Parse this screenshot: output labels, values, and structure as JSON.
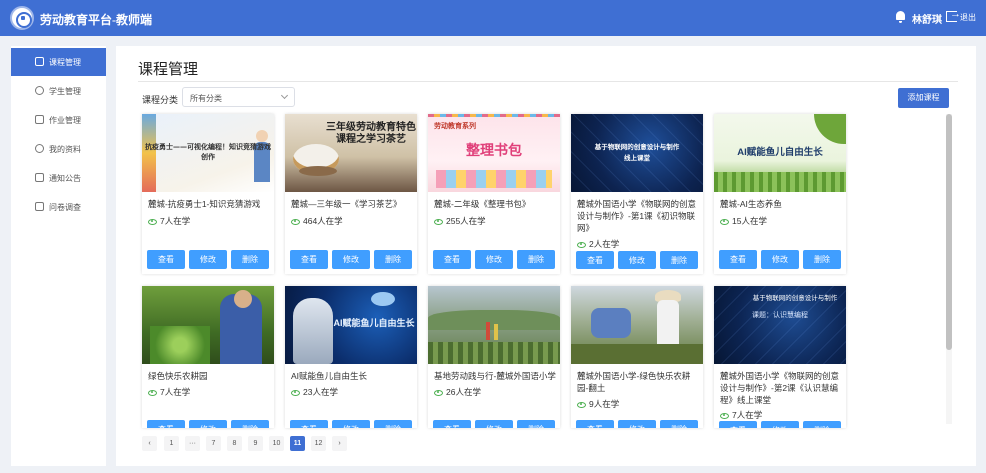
{
  "header": {
    "app_title": "劳动教育平台-教师端",
    "username": "林舒琪",
    "logout_label": "退出"
  },
  "sidebar": {
    "items": [
      {
        "label": "课程管理",
        "active": true,
        "icon": "document-icon"
      },
      {
        "label": "学生管理",
        "active": false,
        "icon": "student-icon"
      },
      {
        "label": "作业管理",
        "active": false,
        "icon": "homework-icon"
      },
      {
        "label": "我的资料",
        "active": false,
        "icon": "user-icon"
      },
      {
        "label": "通知公告",
        "active": false,
        "icon": "speaker-icon"
      },
      {
        "label": "问卷调查",
        "active": false,
        "icon": "survey-icon"
      }
    ]
  },
  "main": {
    "title": "课程管理",
    "filter_label": "课程分类",
    "filter_value": "所有分类",
    "add_button": "添加课程",
    "actions": {
      "view": "查看",
      "edit": "修改",
      "delete": "删除"
    }
  },
  "courses": [
    {
      "title": "麓城-抗疫勇士1-知识竞猜游戏",
      "learners": "7人在学",
      "thumb_caption": "抗疫勇士——可视化编程！知识竞猜游戏创作"
    },
    {
      "title": "麓城—三年级一《学习茶艺》",
      "learners": "464人在学",
      "thumb_caption": "三年级劳动教育特色课程之学习茶艺"
    },
    {
      "title": "麓城-二年级《整理书包》",
      "learners": "255人在学",
      "thumb_caption": "整理书包",
      "thumb_subcaption": "劳动教育系列"
    },
    {
      "title": "麓城外国语小学《物联网的创意设计与制作》-第1课《初识物联网》",
      "learners": "2人在学",
      "thumb_caption": "基于物联网的创意设计与制作 线上课堂"
    },
    {
      "title": "麓城-AI生态养鱼",
      "learners": "15人在学",
      "thumb_caption": "AI赋能鱼儿自由生长"
    },
    {
      "title": "绿色快乐农耕园",
      "learners": "7人在学"
    },
    {
      "title": "AI赋能鱼儿自由生长",
      "learners": "23人在学",
      "thumb_caption": "AI赋能鱼儿自由生长"
    },
    {
      "title": "基地劳动践与行-麓城外国语小学",
      "learners": "26人在学"
    },
    {
      "title": "麓城外国语小学-绿色快乐农耕园-翻土",
      "learners": "9人在学"
    },
    {
      "title": "麓城外国语小学《物联网的创意设计与制作》-第2课《认识慧编程》线上课堂",
      "learners": "7人在学",
      "thumb_caption": "基于物联网的创意设计与制作",
      "thumb_subcaption": "课题：认识慧编程"
    }
  ],
  "pagination": {
    "pages": [
      "1",
      "···",
      "7",
      "8",
      "9",
      "10",
      "11",
      "12"
    ],
    "current": "11",
    "prev": "‹",
    "next": "›"
  },
  "colors": {
    "primary": "#3f6fd3",
    "action_button": "#409eff",
    "eye_green": "#4caf50"
  }
}
